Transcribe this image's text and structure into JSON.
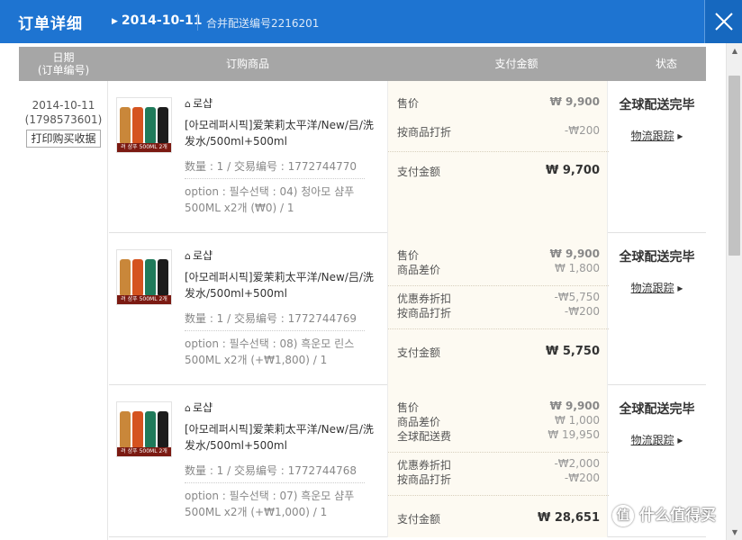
{
  "window": {
    "title": "订单详细",
    "date": "2014-10-11",
    "merge_label": "合并配送编号2216201",
    "close_icon": "close-icon"
  },
  "table": {
    "headers": {
      "date_line1": "日期",
      "date_line2": "(订单编号)",
      "product": "订购商品",
      "payment": "支付金额",
      "status": "状态"
    }
  },
  "order": {
    "date": "2014-10-11",
    "number": "(1798573601)",
    "print_button": "打印购买收据"
  },
  "items": [
    {
      "shop": "로샵",
      "name": "[아모레퍼시픽]爱茉莉太平洋/New/吕/洗发水/500ml+500ml",
      "qty": "数量 : 1 / 交易编号 : 1772744770",
      "option": "option : 필수선택 : 04) 청아모 샴푸 500ML x2개 (₩0) / 1",
      "image_caption": "려 샴푸 500ML 2개",
      "payment": {
        "lines": [
          {
            "label": "售价",
            "value": "₩ 9,900"
          },
          {
            "label": "按商品打折",
            "value": "-₩200"
          }
        ],
        "total_label": "支付金额",
        "total_value": "₩ 9,700"
      },
      "status": "全球配送完毕",
      "tracking": "物流跟踪"
    },
    {
      "shop": "로샵",
      "name": "[아모레퍼시픽]爱茉莉太平洋/New/吕/洗发水/500ml+500ml",
      "qty": "数量 : 1 / 交易编号 : 1772744769",
      "option": "option : 필수선택 : 08) 흑운모 린스 500ML x2개 (+₩1,800) / 1",
      "image_caption": "려 샴푸 500ML 2개",
      "payment": {
        "group1": [
          {
            "label": "售价",
            "value": "₩ 9,900"
          },
          {
            "label": "商品差价",
            "value": "₩ 1,800"
          }
        ],
        "group2": [
          {
            "label": "优惠券折扣",
            "value": "-₩5,750"
          },
          {
            "label": "按商品打折",
            "value": "-₩200"
          }
        ],
        "total_label": "支付金额",
        "total_value": "₩ 5,750"
      },
      "status": "全球配送完毕",
      "tracking": "物流跟踪"
    },
    {
      "shop": "로샵",
      "name": "[아모레퍼시픽]爱茉莉太平洋/New/吕/洗发水/500ml+500ml",
      "qty": "数量 : 1 / 交易编号 : 1772744768",
      "option": "option : 필수선택 : 07) 흑운모 샴푸 500ML x2개 (+₩1,000) / 1",
      "image_caption": "려 샴푸 500ML 2개",
      "payment": {
        "group1": [
          {
            "label": "售价",
            "value": "₩ 9,900"
          },
          {
            "label": "商品差价",
            "value": "₩ 1,000"
          },
          {
            "label": "全球配送费",
            "value": "₩ 19,950"
          }
        ],
        "group2": [
          {
            "label": "优惠券折扣",
            "value": "-₩2,000"
          },
          {
            "label": "按商品打折",
            "value": "-₩200"
          }
        ],
        "total_label": "支付金额",
        "total_value": "₩ 28,651"
      },
      "status": "全球配送完毕",
      "tracking": "物流跟踪"
    }
  ],
  "watermark": "什么值得买",
  "colors": {
    "titlebar": "#1e74d1",
    "header": "#a6a6a6",
    "payment_bg": "#fdfaf2"
  }
}
